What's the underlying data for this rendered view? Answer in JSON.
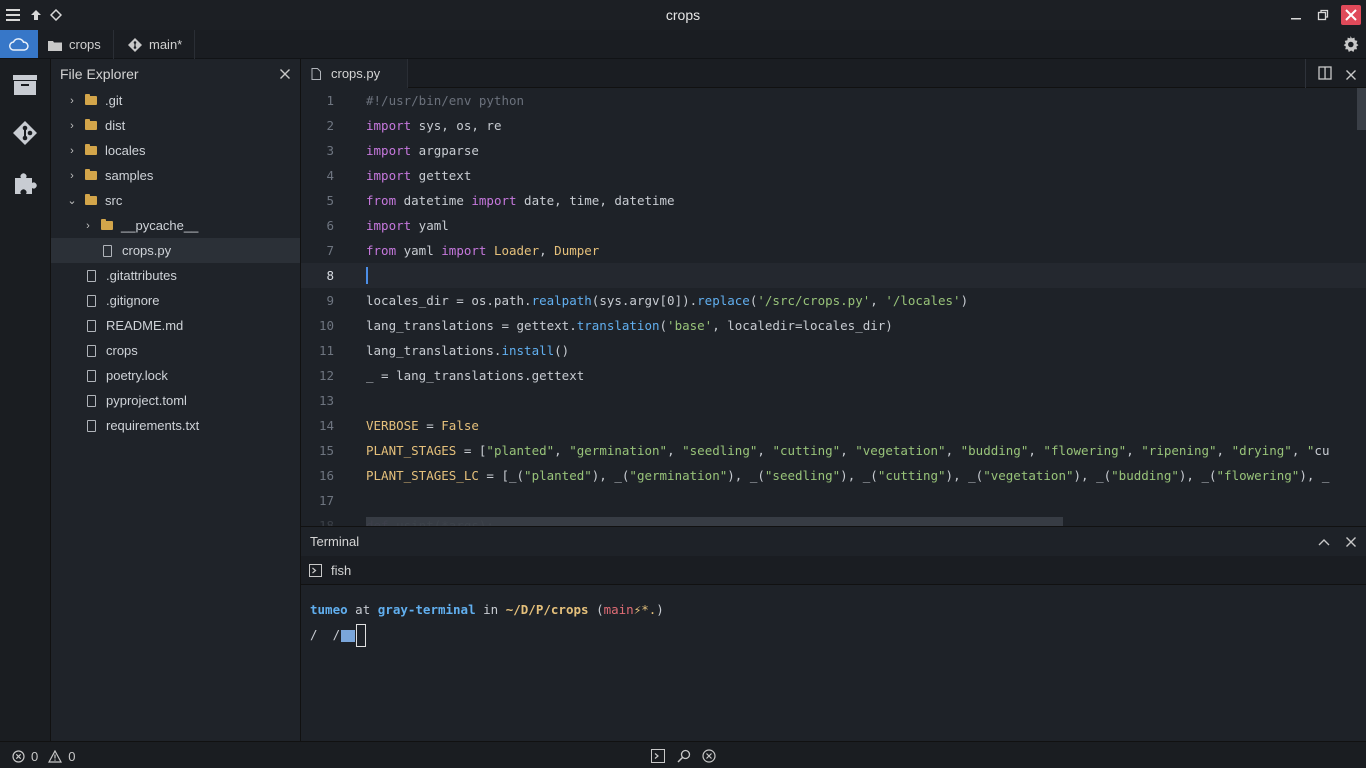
{
  "window": {
    "title": "crops"
  },
  "tabbar": {
    "project": "crops",
    "branch": "main*"
  },
  "explorer": {
    "title": "File Explorer",
    "items": [
      {
        "name": ".git",
        "type": "folder",
        "depth": 0,
        "open": false
      },
      {
        "name": "dist",
        "type": "folder",
        "depth": 0,
        "open": false
      },
      {
        "name": "locales",
        "type": "folder",
        "depth": 0,
        "open": false
      },
      {
        "name": "samples",
        "type": "folder",
        "depth": 0,
        "open": false
      },
      {
        "name": "src",
        "type": "folder",
        "depth": 0,
        "open": true
      },
      {
        "name": "__pycache__",
        "type": "folder",
        "depth": 1,
        "open": false
      },
      {
        "name": "crops.py",
        "type": "file",
        "depth": 1,
        "selected": true
      },
      {
        "name": ".gitattributes",
        "type": "file",
        "depth": 0
      },
      {
        "name": ".gitignore",
        "type": "file",
        "depth": 0
      },
      {
        "name": "README.md",
        "type": "file",
        "depth": 0
      },
      {
        "name": "crops",
        "type": "file",
        "depth": 0
      },
      {
        "name": "poetry.lock",
        "type": "file",
        "depth": 0
      },
      {
        "name": "pyproject.toml",
        "type": "file",
        "depth": 0
      },
      {
        "name": "requirements.txt",
        "type": "file",
        "depth": 0
      }
    ]
  },
  "editor": {
    "tab": "crops.py",
    "current_line": 8,
    "lines": [
      "#!/usr/bin/env python",
      "import sys, os, re",
      "import argparse",
      "import gettext",
      "from datetime import date, time, datetime",
      "import yaml",
      "from yaml import Loader, Dumper",
      "",
      "locales_dir = os.path.realpath(sys.argv[0]).replace('/src/crops.py', '/locales')",
      "lang_translations = gettext.translation('base', localedir=locales_dir)",
      "lang_translations.install()",
      "_ = lang_translations.gettext",
      "",
      "VERBOSE = False",
      "PLANT_STAGES = [\"planted\", \"germination\", \"seedling\", \"cutting\", \"vegetation\", \"budding\", \"flowering\", \"ripening\", \"drying\", \"cu",
      "PLANT_STAGES_LC = [_(\"planted\"), _(\"germination\"), _(\"seedling\"), _(\"cutting\"), _(\"vegetation\"), _(\"budding\"), _(\"flowering\"), _",
      "",
      "def usint(*args):"
    ]
  },
  "terminal": {
    "title": "Terminal",
    "tab": "fish",
    "prompt": {
      "user": "tumeo",
      "at": "at",
      "host": "gray-terminal",
      "in": "in",
      "path": "~/D/P/crops",
      "branch_open": "(",
      "branch": "main",
      "branch_flags": "⚡*.",
      "branch_close": ")"
    },
    "input": "/  /"
  },
  "status": {
    "errors": "0",
    "warnings": "0"
  },
  "colors": {
    "accent": "#3777c8",
    "close": "#e04a5a",
    "folder": "#d3a54a"
  }
}
